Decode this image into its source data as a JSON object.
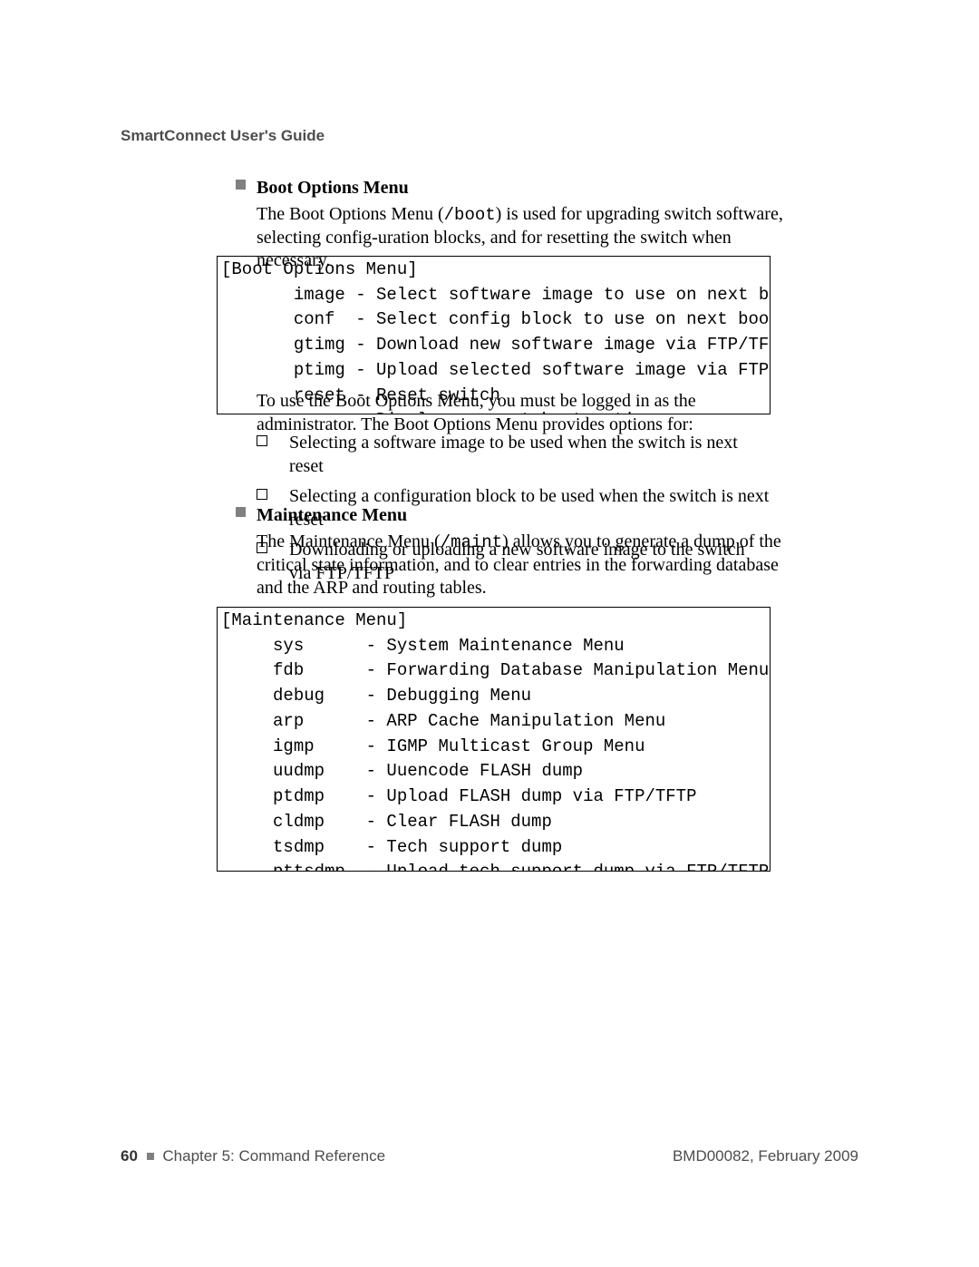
{
  "header": {
    "running_head": "SmartConnect User's Guide"
  },
  "sections": {
    "boot": {
      "title": "Boot Options Menu",
      "para1_a": "The Boot Options Menu (",
      "para1_code": "/boot",
      "para1_b": ") is used for upgrading switch software, selecting config-uration blocks, and for resetting the switch when necessary.",
      "codebox": "[Boot Options Menu]\n       image - Select software image to use on next boot\n       conf  - Select config block to use on next boot\n       gtimg - Download new software image via FTP/TFTP\n       ptimg - Upload selected software image via FTP/TFTP\n       reset - Reset switch\n       cur   - Display current boot options",
      "para2": "To use the Boot Options Menu, you must be logged in as the administrator. The Boot Options Menu provides options for:",
      "bullets": [
        "Selecting a software image to be used when the switch is next reset",
        "Selecting a configuration block to be used when the switch is next reset",
        "Downloading or uploading a new software image to the switch via FTP/TFTP"
      ]
    },
    "maint": {
      "title": "Maintenance Menu",
      "para1_a": "The Maintenance Menu (",
      "para1_code": "/maint",
      "para1_b": ") allows you to generate a dump of the critical state information, and to clear entries in the forwarding database and the ARP and routing tables.",
      "codebox": "[Maintenance Menu]\n     sys      - System Maintenance Menu\n     fdb      - Forwarding Database Manipulation Menu\n     debug    - Debugging Menu\n     arp      - ARP Cache Manipulation Menu\n     igmp     - IGMP Multicast Group Menu\n     uudmp    - Uuencode FLASH dump\n     ptdmp    - Upload FLASH dump via FTP/TFTP\n     cldmp    - Clear FLASH dump\n     tsdmp    - Tech support dump\n     pttsdmp  - Upload tech support dump via FTP/TFTP"
    }
  },
  "footer": {
    "page_number": "60",
    "chapter_label": "Chapter 5: Command Reference",
    "doc_id": "BMD00082, February 2009"
  }
}
